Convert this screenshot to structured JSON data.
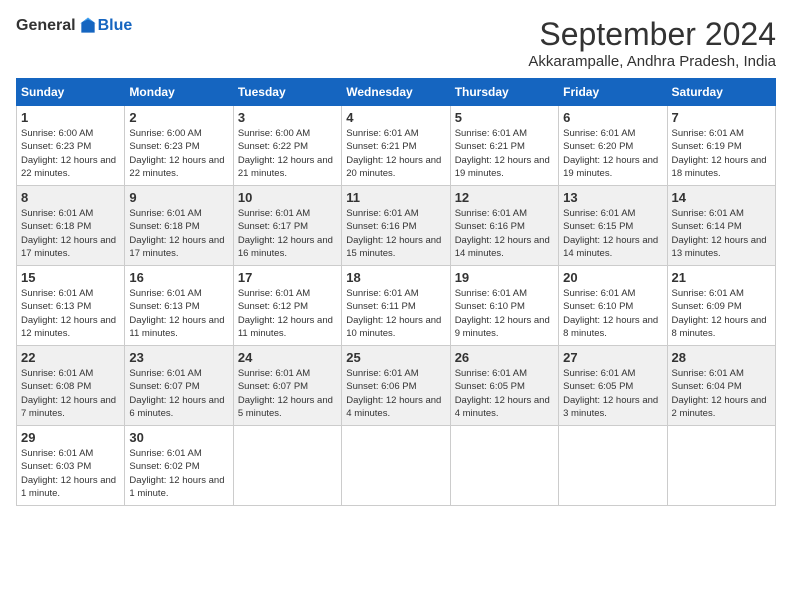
{
  "header": {
    "logo_general": "General",
    "logo_blue": "Blue",
    "title": "September 2024",
    "location": "Akkarampalle, Andhra Pradesh, India"
  },
  "columns": [
    "Sunday",
    "Monday",
    "Tuesday",
    "Wednesday",
    "Thursday",
    "Friday",
    "Saturday"
  ],
  "weeks": [
    [
      {
        "day": "1",
        "sunrise": "6:00 AM",
        "sunset": "6:23 PM",
        "daylight": "12 hours and 22 minutes."
      },
      {
        "day": "2",
        "sunrise": "6:00 AM",
        "sunset": "6:23 PM",
        "daylight": "12 hours and 22 minutes."
      },
      {
        "day": "3",
        "sunrise": "6:00 AM",
        "sunset": "6:22 PM",
        "daylight": "12 hours and 21 minutes."
      },
      {
        "day": "4",
        "sunrise": "6:01 AM",
        "sunset": "6:21 PM",
        "daylight": "12 hours and 20 minutes."
      },
      {
        "day": "5",
        "sunrise": "6:01 AM",
        "sunset": "6:21 PM",
        "daylight": "12 hours and 19 minutes."
      },
      {
        "day": "6",
        "sunrise": "6:01 AM",
        "sunset": "6:20 PM",
        "daylight": "12 hours and 19 minutes."
      },
      {
        "day": "7",
        "sunrise": "6:01 AM",
        "sunset": "6:19 PM",
        "daylight": "12 hours and 18 minutes."
      }
    ],
    [
      {
        "day": "8",
        "sunrise": "6:01 AM",
        "sunset": "6:18 PM",
        "daylight": "12 hours and 17 minutes."
      },
      {
        "day": "9",
        "sunrise": "6:01 AM",
        "sunset": "6:18 PM",
        "daylight": "12 hours and 17 minutes."
      },
      {
        "day": "10",
        "sunrise": "6:01 AM",
        "sunset": "6:17 PM",
        "daylight": "12 hours and 16 minutes."
      },
      {
        "day": "11",
        "sunrise": "6:01 AM",
        "sunset": "6:16 PM",
        "daylight": "12 hours and 15 minutes."
      },
      {
        "day": "12",
        "sunrise": "6:01 AM",
        "sunset": "6:16 PM",
        "daylight": "12 hours and 14 minutes."
      },
      {
        "day": "13",
        "sunrise": "6:01 AM",
        "sunset": "6:15 PM",
        "daylight": "12 hours and 14 minutes."
      },
      {
        "day": "14",
        "sunrise": "6:01 AM",
        "sunset": "6:14 PM",
        "daylight": "12 hours and 13 minutes."
      }
    ],
    [
      {
        "day": "15",
        "sunrise": "6:01 AM",
        "sunset": "6:13 PM",
        "daylight": "12 hours and 12 minutes."
      },
      {
        "day": "16",
        "sunrise": "6:01 AM",
        "sunset": "6:13 PM",
        "daylight": "12 hours and 11 minutes."
      },
      {
        "day": "17",
        "sunrise": "6:01 AM",
        "sunset": "6:12 PM",
        "daylight": "12 hours and 11 minutes."
      },
      {
        "day": "18",
        "sunrise": "6:01 AM",
        "sunset": "6:11 PM",
        "daylight": "12 hours and 10 minutes."
      },
      {
        "day": "19",
        "sunrise": "6:01 AM",
        "sunset": "6:10 PM",
        "daylight": "12 hours and 9 minutes."
      },
      {
        "day": "20",
        "sunrise": "6:01 AM",
        "sunset": "6:10 PM",
        "daylight": "12 hours and 8 minutes."
      },
      {
        "day": "21",
        "sunrise": "6:01 AM",
        "sunset": "6:09 PM",
        "daylight": "12 hours and 8 minutes."
      }
    ],
    [
      {
        "day": "22",
        "sunrise": "6:01 AM",
        "sunset": "6:08 PM",
        "daylight": "12 hours and 7 minutes."
      },
      {
        "day": "23",
        "sunrise": "6:01 AM",
        "sunset": "6:07 PM",
        "daylight": "12 hours and 6 minutes."
      },
      {
        "day": "24",
        "sunrise": "6:01 AM",
        "sunset": "6:07 PM",
        "daylight": "12 hours and 5 minutes."
      },
      {
        "day": "25",
        "sunrise": "6:01 AM",
        "sunset": "6:06 PM",
        "daylight": "12 hours and 4 minutes."
      },
      {
        "day": "26",
        "sunrise": "6:01 AM",
        "sunset": "6:05 PM",
        "daylight": "12 hours and 4 minutes."
      },
      {
        "day": "27",
        "sunrise": "6:01 AM",
        "sunset": "6:05 PM",
        "daylight": "12 hours and 3 minutes."
      },
      {
        "day": "28",
        "sunrise": "6:01 AM",
        "sunset": "6:04 PM",
        "daylight": "12 hours and 2 minutes."
      }
    ],
    [
      {
        "day": "29",
        "sunrise": "6:01 AM",
        "sunset": "6:03 PM",
        "daylight": "12 hours and 1 minute."
      },
      {
        "day": "30",
        "sunrise": "6:01 AM",
        "sunset": "6:02 PM",
        "daylight": "12 hours and 1 minute."
      },
      null,
      null,
      null,
      null,
      null
    ]
  ],
  "labels": {
    "sunrise_prefix": "Sunrise: ",
    "sunset_prefix": "Sunset: ",
    "daylight_prefix": "Daylight: "
  }
}
